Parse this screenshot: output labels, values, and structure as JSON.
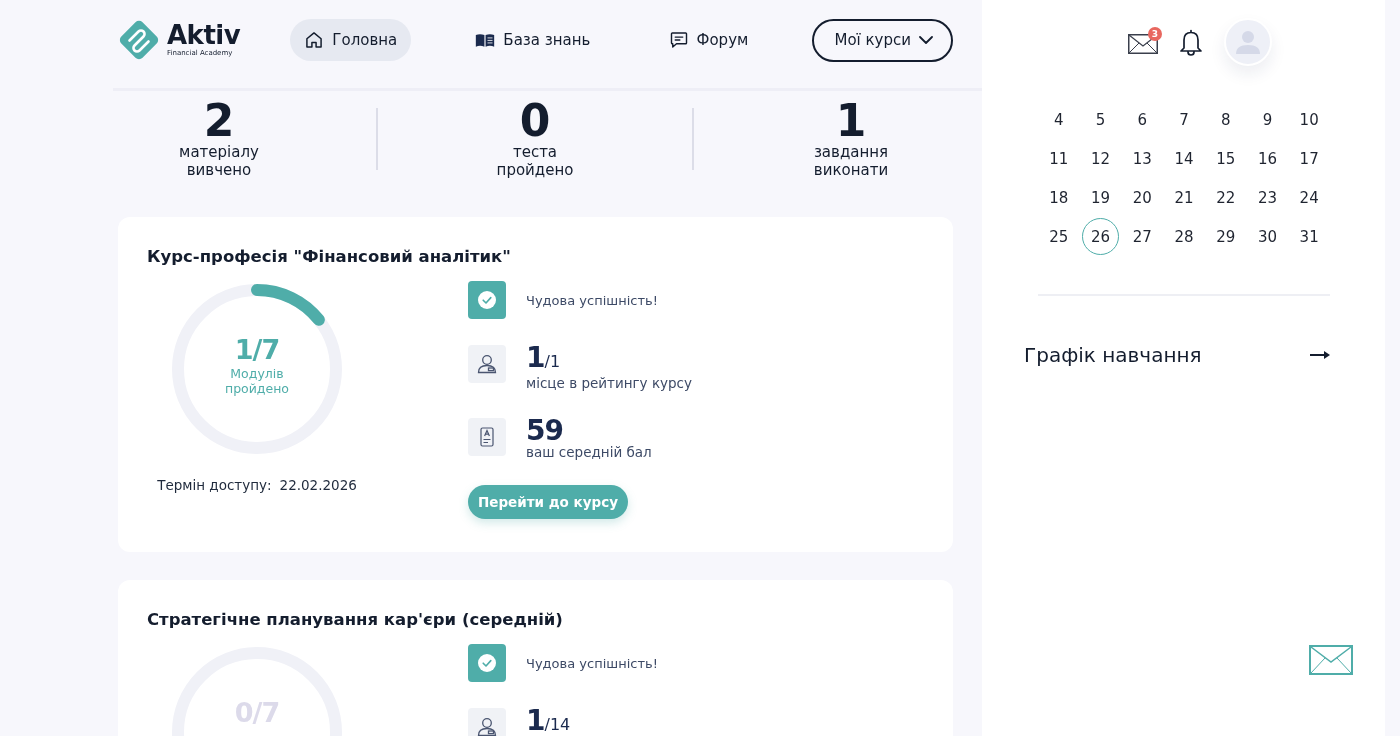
{
  "logo": {
    "name": "Aktiv",
    "tagline": "Financial Academy"
  },
  "nav": {
    "items": [
      {
        "label": "Головна",
        "selected": true
      },
      {
        "label": "База знань",
        "selected": false
      },
      {
        "label": "Форум",
        "selected": false
      }
    ],
    "my_courses": {
      "label": "Мої курси"
    }
  },
  "header": {
    "messages_badge": "3"
  },
  "stats": [
    {
      "value": "2",
      "label": "матеріалу\nвивчено"
    },
    {
      "value": "0",
      "label": "теста\nпройдено"
    },
    {
      "value": "1",
      "label": "завдання\nвиконати"
    }
  ],
  "courses": [
    {
      "title": "Курс-професія \"Фінансовий аналітик\"",
      "progress": {
        "text": "1/7",
        "caption": "Модулів\nпройдено",
        "level": 0.142857
      },
      "access": {
        "label": "Термін доступу:",
        "date": "22.02.2026"
      },
      "status": "Чудова успішність!",
      "rank": {
        "place": "1",
        "of": "/1",
        "label": "місце в рейтингу курсу"
      },
      "score": {
        "value": "59",
        "label": "ваш середній бал"
      },
      "button": "Перейти до курсу"
    },
    {
      "title": "Стратегічне планування кар'єри (середній)",
      "progress": {
        "text": "0/7",
        "level": 0
      },
      "status": "Чудова успішність!",
      "rank": {
        "place": "1",
        "of": "/14"
      }
    }
  ],
  "calendar": {
    "days": [
      {
        "label": "4",
        "selected": false
      },
      {
        "label": "5",
        "selected": false
      },
      {
        "label": "6",
        "selected": false
      },
      {
        "label": "7",
        "selected": false
      },
      {
        "label": "8",
        "selected": false
      },
      {
        "label": "9",
        "selected": false
      },
      {
        "label": "10",
        "selected": false
      },
      {
        "label": "11",
        "selected": false
      },
      {
        "label": "12",
        "selected": false
      },
      {
        "label": "13",
        "selected": false
      },
      {
        "label": "14",
        "selected": false
      },
      {
        "label": "15",
        "selected": false
      },
      {
        "label": "16",
        "selected": false
      },
      {
        "label": "17",
        "selected": false
      },
      {
        "label": "18",
        "selected": false
      },
      {
        "label": "19",
        "selected": false
      },
      {
        "label": "20",
        "selected": false
      },
      {
        "label": "21",
        "selected": false
      },
      {
        "label": "22",
        "selected": false
      },
      {
        "label": "23",
        "selected": false
      },
      {
        "label": "24",
        "selected": false
      },
      {
        "label": "25",
        "selected": false
      },
      {
        "label": "26",
        "selected": true
      },
      {
        "label": "27",
        "selected": false
      },
      {
        "label": "28",
        "selected": false
      },
      {
        "label": "29",
        "selected": false
      },
      {
        "label": "30",
        "selected": false
      },
      {
        "label": "31",
        "selected": false
      }
    ]
  },
  "schedule_link": {
    "label": "Графік навчання"
  }
}
